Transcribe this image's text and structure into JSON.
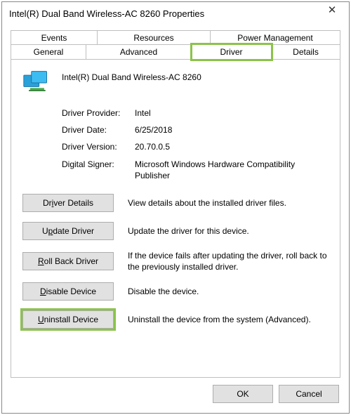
{
  "title": "Intel(R) Dual Band Wireless-AC 8260 Properties",
  "tabs_top": [
    "Events",
    "Resources",
    "Power Management"
  ],
  "tabs_bottom": [
    "General",
    "Advanced",
    "Driver",
    "Details"
  ],
  "active_tab": "Driver",
  "device_name": "Intel(R) Dual Band Wireless-AC 8260",
  "props": {
    "provider_label": "Driver Provider:",
    "provider_value": "Intel",
    "date_label": "Driver Date:",
    "date_value": "6/25/2018",
    "version_label": "Driver Version:",
    "version_value": "20.70.0.5",
    "signer_label": "Digital Signer:",
    "signer_value": "Microsoft Windows Hardware Compatibility Publisher"
  },
  "actions": {
    "details_btn": "Driver Details",
    "details_desc": "View details about the installed driver files.",
    "update_btn": "Update Driver",
    "update_desc": "Update the driver for this device.",
    "rollback_btn": "Roll Back Driver",
    "rollback_desc": "If the device fails after updating the driver, roll back to the previously installed driver.",
    "disable_btn": "Disable Device",
    "disable_desc": "Disable the device.",
    "uninstall_btn": "Uninstall Device",
    "uninstall_desc": "Uninstall the device from the system (Advanced)."
  },
  "footer": {
    "ok": "OK",
    "cancel": "Cancel"
  },
  "highlight_color": "#8bc34a"
}
